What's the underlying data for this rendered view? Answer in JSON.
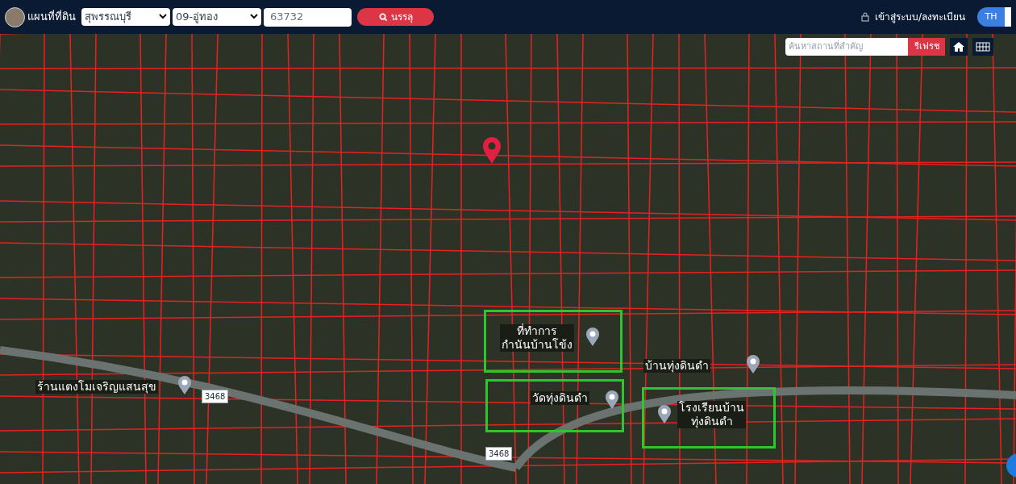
{
  "header": {
    "site_title": "แผนที่ที่ดิน",
    "province": {
      "value": "สุพรรณบุรี"
    },
    "district": {
      "value": "09-อู่ทอง"
    },
    "parcel_number": {
      "value": "63732"
    },
    "search_button": "นรรลุ",
    "login_link": "เข้าสู่ระบบ/ลงทะเบียน",
    "language": [
      {
        "label": "TH",
        "selected": true
      }
    ]
  },
  "map": {
    "place_search": {
      "placeholder": "ค้นหาสถานที่สำคัญ"
    },
    "refresh_button": "รีเฟรช",
    "labels": [
      {
        "kind": "poi",
        "text": "ที่ทำการ\nกำนันบ้านโข้ง"
      },
      {
        "kind": "poi",
        "text": "บ้านทุ่งดินดำ"
      },
      {
        "kind": "poi",
        "text": "วัดทุ่งดินดำ"
      },
      {
        "kind": "poi",
        "text": "โรงเรียนบ้าน\nทุ่งดินดำ"
      },
      {
        "kind": "poi",
        "text": "ร้านแตงโมเจริญแสนสุข"
      },
      {
        "kind": "road",
        "text": "3468"
      },
      {
        "kind": "road",
        "text": "3468"
      }
    ]
  }
}
